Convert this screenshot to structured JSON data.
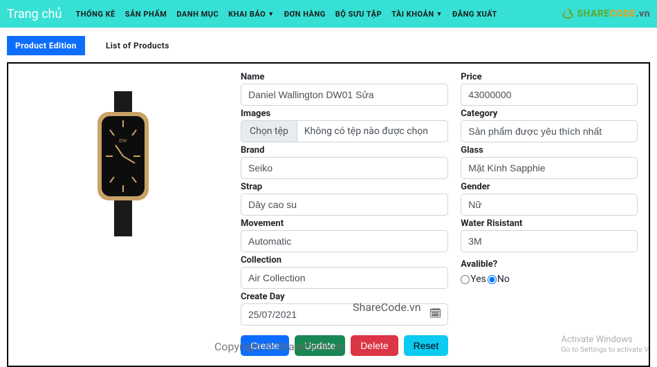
{
  "brand": "Trang chủ",
  "nav": {
    "stats": "THỐNG KÊ",
    "products": "SẢN PHẨM",
    "categories": "DANH MỤC",
    "declare": "KHAI BÁO",
    "orders": "ĐƠN HÀNG",
    "collection": "BỘ SƯU TẬP",
    "account": "TÀI KHOẢN",
    "logout": "ĐĂNG XUẤT"
  },
  "sharecode": {
    "share": "SHARE",
    "code": "CODE",
    "vn": ".vn"
  },
  "subnav": {
    "edition": "Product Edition",
    "list": "List of Products"
  },
  "labels": {
    "name": "Name",
    "images": "Images",
    "brand": "Brand",
    "strap": "Strap",
    "movement": "Movement",
    "collection": "Collection",
    "createDay": "Create Day",
    "price": "Price",
    "category": "Category",
    "glass": "Glass",
    "gender": "Gender",
    "water": "Water Risistant",
    "available": "Avalible?"
  },
  "values": {
    "name": "Daniel Wallington DW01 Sửa",
    "fileBtn": "Chọn tệp",
    "fileText": "Không có tệp nào được chọn",
    "brand": "Seiko",
    "strap": "Dây cao su",
    "movement": "Automatic",
    "collection": "Air Collection",
    "createDay": "25/07/2021",
    "price": "43000000",
    "category": "Sản phẩm được yêu thích nhất",
    "glass": "Mặt Kính Sapphie",
    "gender": "Nữ",
    "water": "3M",
    "yes": "Yes",
    "no": "No"
  },
  "buttons": {
    "create": "Create",
    "update": "Update",
    "delete": "Delete",
    "reset": "Reset"
  },
  "watermarks": {
    "w1": "ShareCode.vn",
    "w2": "Copyright © ShareCode.vn"
  },
  "activate": {
    "line1": "Activate Windows",
    "line2": "Go to Settings to activate V"
  }
}
